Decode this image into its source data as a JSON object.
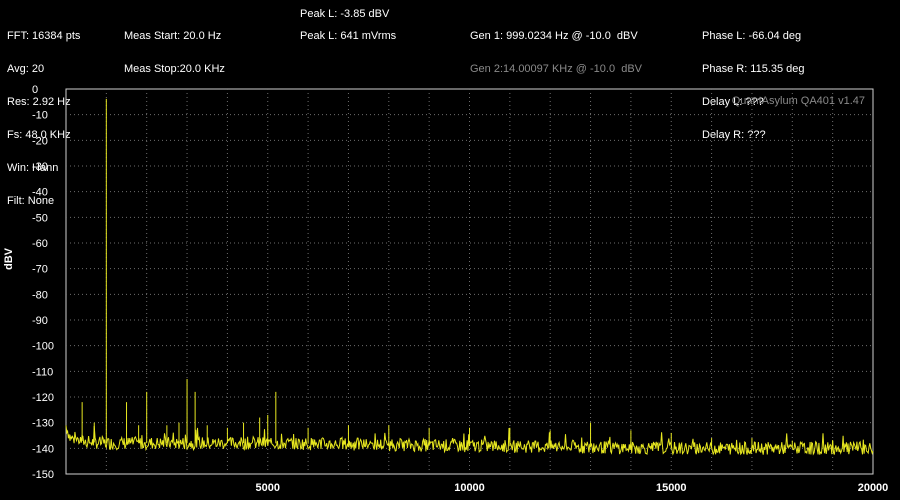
{
  "readouts": {
    "col1": [
      "FFT: 16384 pts",
      "Avg: 20",
      "Res: 2.92 Hz",
      "Fs: 48.0 KHz",
      "Win: Hann",
      "Filt: None"
    ],
    "col2": [
      "Meas Start: 20.0 Hz",
      "Meas Stop:20.0 KHz"
    ],
    "peak_l_dbv": "Peak L: -3.85 dBV",
    "peak_l_vrms": "Peak L: 641 mVrms",
    "gen1": "Gen 1: 999.0234 Hz @ -10.0  dBV",
    "gen2": "Gen 2:14.00097 KHz @ -10.0  dBV",
    "phase_l": "Phase L: -66.04 deg",
    "phase_r": "Phase R: 115.35 deg",
    "delay_l": "Delay L: ???",
    "delay_r": "Delay R: ???"
  },
  "watermark": "QuantAsylum QA401 v1.47",
  "colors": {
    "background": "#000000",
    "trace": "#e8e820",
    "grid": "#6e6e6e",
    "text": "#ffffff",
    "muted_text": "#8a8a8a"
  },
  "chart_data": {
    "type": "line",
    "title": "",
    "xlabel": "",
    "ylabel": "dBV",
    "xlim": [
      0,
      20000
    ],
    "ylim": [
      -150,
      0
    ],
    "x_ticks": [
      5000,
      10000,
      15000,
      20000
    ],
    "y_ticks": [
      0,
      -10,
      -20,
      -30,
      -40,
      -50,
      -60,
      -70,
      -80,
      -90,
      -100,
      -110,
      -120,
      -130,
      -140,
      -150
    ],
    "grid": true,
    "series": [
      {
        "noise_floor": [
          [
            0,
            -131
          ],
          [
            100,
            -136
          ],
          [
            500,
            -137.5
          ],
          [
            1000,
            -138
          ],
          [
            5000,
            -138
          ],
          [
            10000,
            -139
          ],
          [
            15000,
            -140
          ],
          [
            20000,
            -140
          ]
        ],
        "peaks": [
          [
            999,
            -3.85
          ],
          [
            400,
            -122
          ],
          [
            700,
            -130
          ],
          [
            1500,
            -122
          ],
          [
            1800,
            -131
          ],
          [
            2000,
            -118
          ],
          [
            2500,
            -131
          ],
          [
            2800,
            -130
          ],
          [
            3000,
            -113
          ],
          [
            3200,
            -118
          ],
          [
            3500,
            -131
          ],
          [
            4000,
            -132
          ],
          [
            4400,
            -130
          ],
          [
            4800,
            -128
          ],
          [
            5000,
            -127
          ],
          [
            5200,
            -118
          ],
          [
            6000,
            -132
          ],
          [
            7000,
            -131
          ],
          [
            8000,
            -131
          ],
          [
            9000,
            -132
          ],
          [
            10000,
            -132
          ],
          [
            11000,
            -132
          ],
          [
            12000,
            -133
          ],
          [
            13000,
            -130
          ],
          [
            14000,
            -133
          ],
          [
            15000,
            -134
          ],
          [
            16000,
            -136
          ],
          [
            17000,
            -136
          ],
          [
            18000,
            -137
          ],
          [
            19000,
            -137
          ]
        ]
      }
    ]
  }
}
